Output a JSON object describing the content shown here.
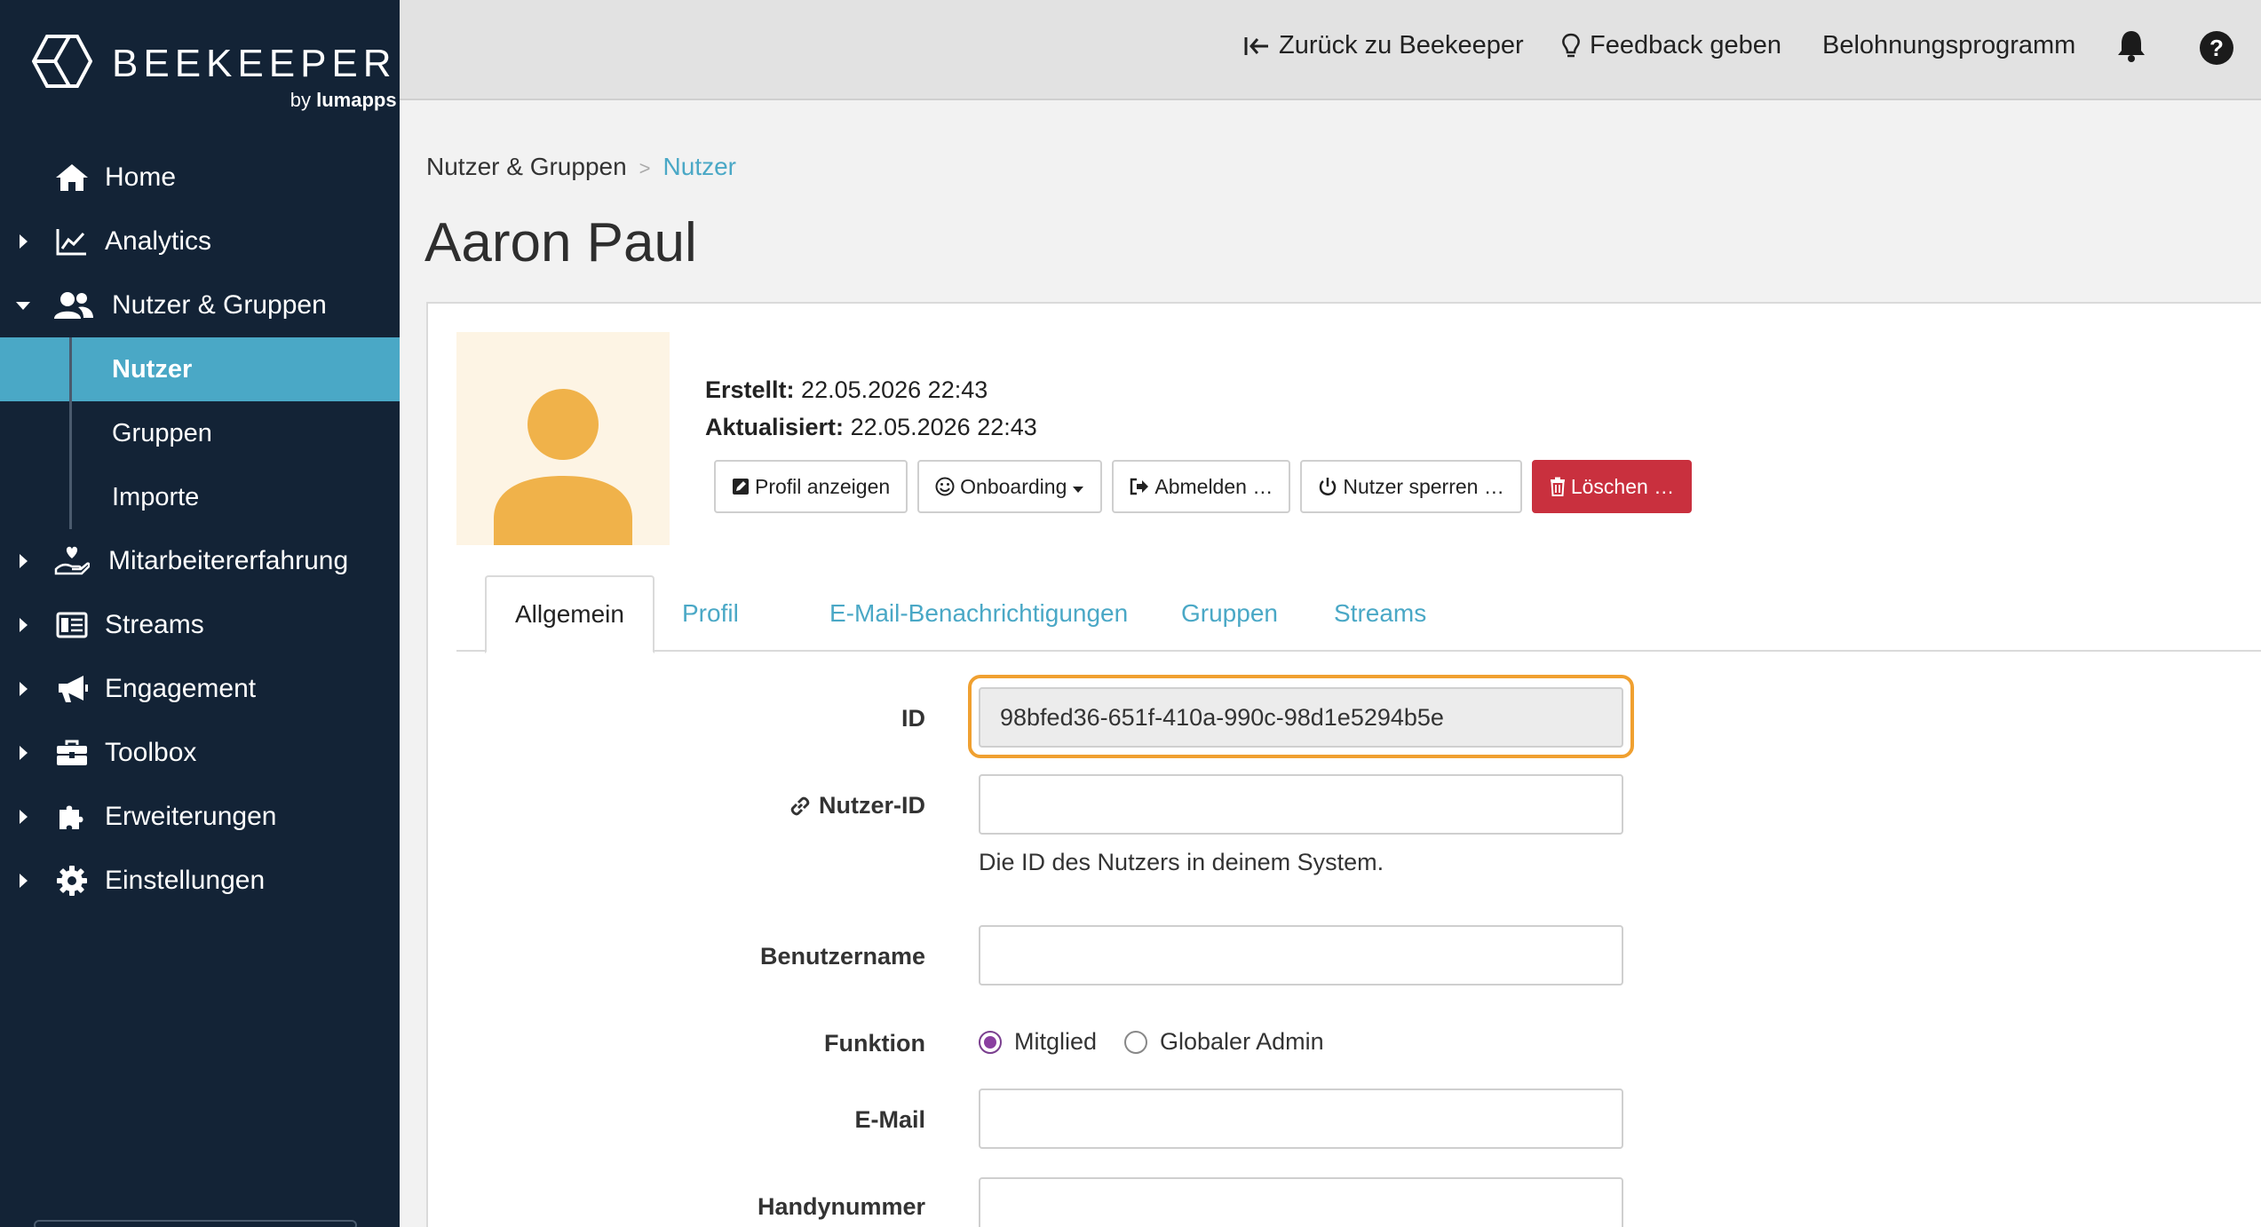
{
  "brand": {
    "name": "BEEKEEPER",
    "by": "by",
    "partner": "lumapps"
  },
  "topbar": {
    "back": "Zurück zu Beekeeper",
    "feedback": "Feedback geben",
    "rewards": "Belohnungsprogramm"
  },
  "sidebar": {
    "home": "Home",
    "analytics": "Analytics",
    "users_groups": "Nutzer & Gruppen",
    "users": "Nutzer",
    "groups": "Gruppen",
    "imports": "Importe",
    "employee_experience": "Mitarbeitererfahrung",
    "streams": "Streams",
    "engagement": "Engagement",
    "toolbox": "Toolbox",
    "extensions": "Erweiterungen",
    "settings": "Einstellungen"
  },
  "breadcrumb": {
    "parent": "Nutzer & Gruppen",
    "separator": ">",
    "current": "Nutzer"
  },
  "page": {
    "title": "Aaron Paul"
  },
  "meta": {
    "created_label": "Erstellt:",
    "created_value": "22.05.2026 22:43",
    "updated_label": "Aktualisiert:",
    "updated_value": "22.05.2026 22:43"
  },
  "actions": {
    "view_profile": "Profil anzeigen",
    "onboarding": "Onboarding",
    "logout": "Abmelden …",
    "lock": "Nutzer sperren …",
    "delete": "Löschen …"
  },
  "tabs": {
    "general": "Allgemein",
    "profile": "Profil",
    "email_notifications": "E-Mail-Benachrichtigungen",
    "groups": "Gruppen",
    "streams": "Streams"
  },
  "form": {
    "id_label": "ID",
    "id_value": "98bfed36-651f-410a-990c-98d1e5294b5e",
    "user_id_label": "Nutzer-ID",
    "user_id_value": "",
    "user_id_hint": "Die ID des Nutzers in deinem System.",
    "username_label": "Benutzername",
    "username_value": "",
    "role_label": "Funktion",
    "role_member": "Mitglied",
    "role_admin": "Globaler Admin",
    "role_selected": "Mitglied",
    "email_label": "E-Mail",
    "email_value": "",
    "phone_label": "Handynummer",
    "phone_value": ""
  },
  "colors": {
    "sidebar_bg": "#132336",
    "accent": "#4aa8c6",
    "danger": "#c9303e",
    "highlight": "#f0a030",
    "avatar": "#f0b24a"
  }
}
